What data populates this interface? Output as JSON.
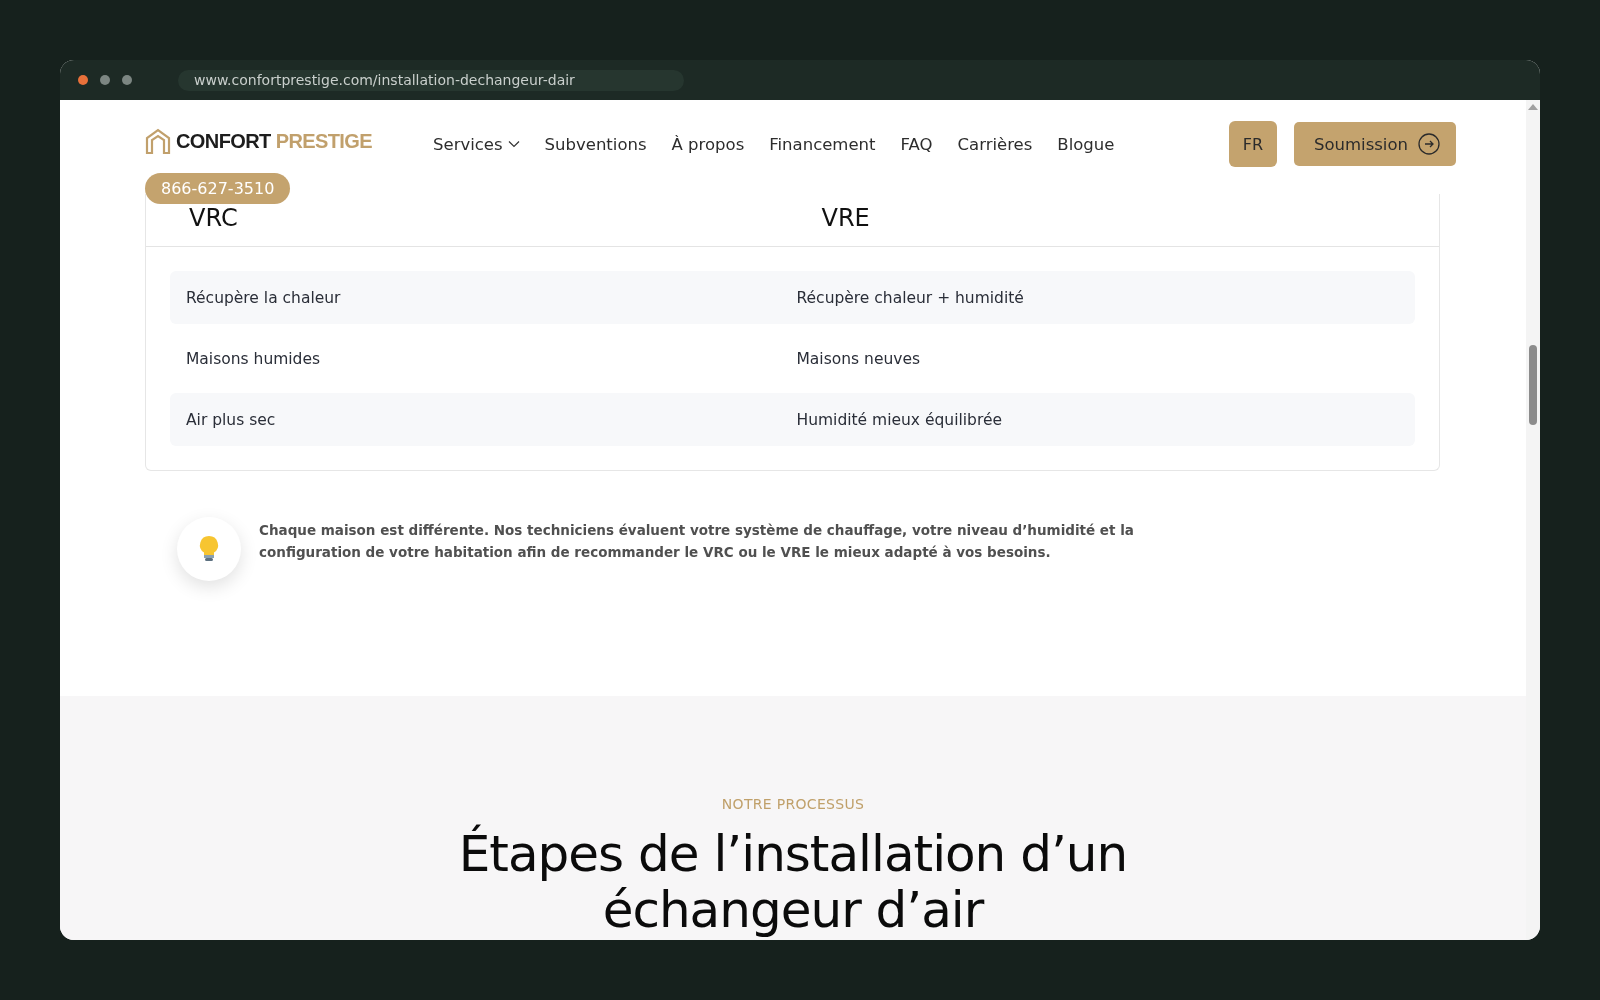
{
  "browser": {
    "url": "www.confortprestige.com/installation-dechangeur-dair"
  },
  "header": {
    "logo": {
      "word1": "CONFORT",
      "word2": "PRESTIGE"
    },
    "nav": [
      {
        "label": "Services",
        "dropdown": true
      },
      {
        "label": "Subventions",
        "dropdown": false
      },
      {
        "label": "À propos",
        "dropdown": false
      },
      {
        "label": "Financement",
        "dropdown": false
      },
      {
        "label": "FAQ",
        "dropdown": false
      },
      {
        "label": "Carrières",
        "dropdown": false
      },
      {
        "label": "Blogue",
        "dropdown": false
      }
    ],
    "language": "FR",
    "cta": "Soumission",
    "phone": "866-627-3510"
  },
  "comparison": {
    "columns": [
      "VRC",
      "VRE"
    ],
    "rows": [
      [
        "Récupère la chaleur",
        "Récupère chaleur + humidité"
      ],
      [
        "Maisons humides",
        "Maisons neuves"
      ],
      [
        "Air plus sec",
        "Humidité mieux équilibrée"
      ]
    ]
  },
  "tip": {
    "text": "Chaque maison est différente. Nos techniciens évaluent votre système de chauffage, votre niveau d’humidité et la configuration de votre habitation afin de recommander le VRC ou le VRE le mieux adapté à vos besoins."
  },
  "process": {
    "eyebrow": "NOTRE PROCESSUS",
    "title": "Étapes de l’installation d’un échangeur d’air"
  }
}
